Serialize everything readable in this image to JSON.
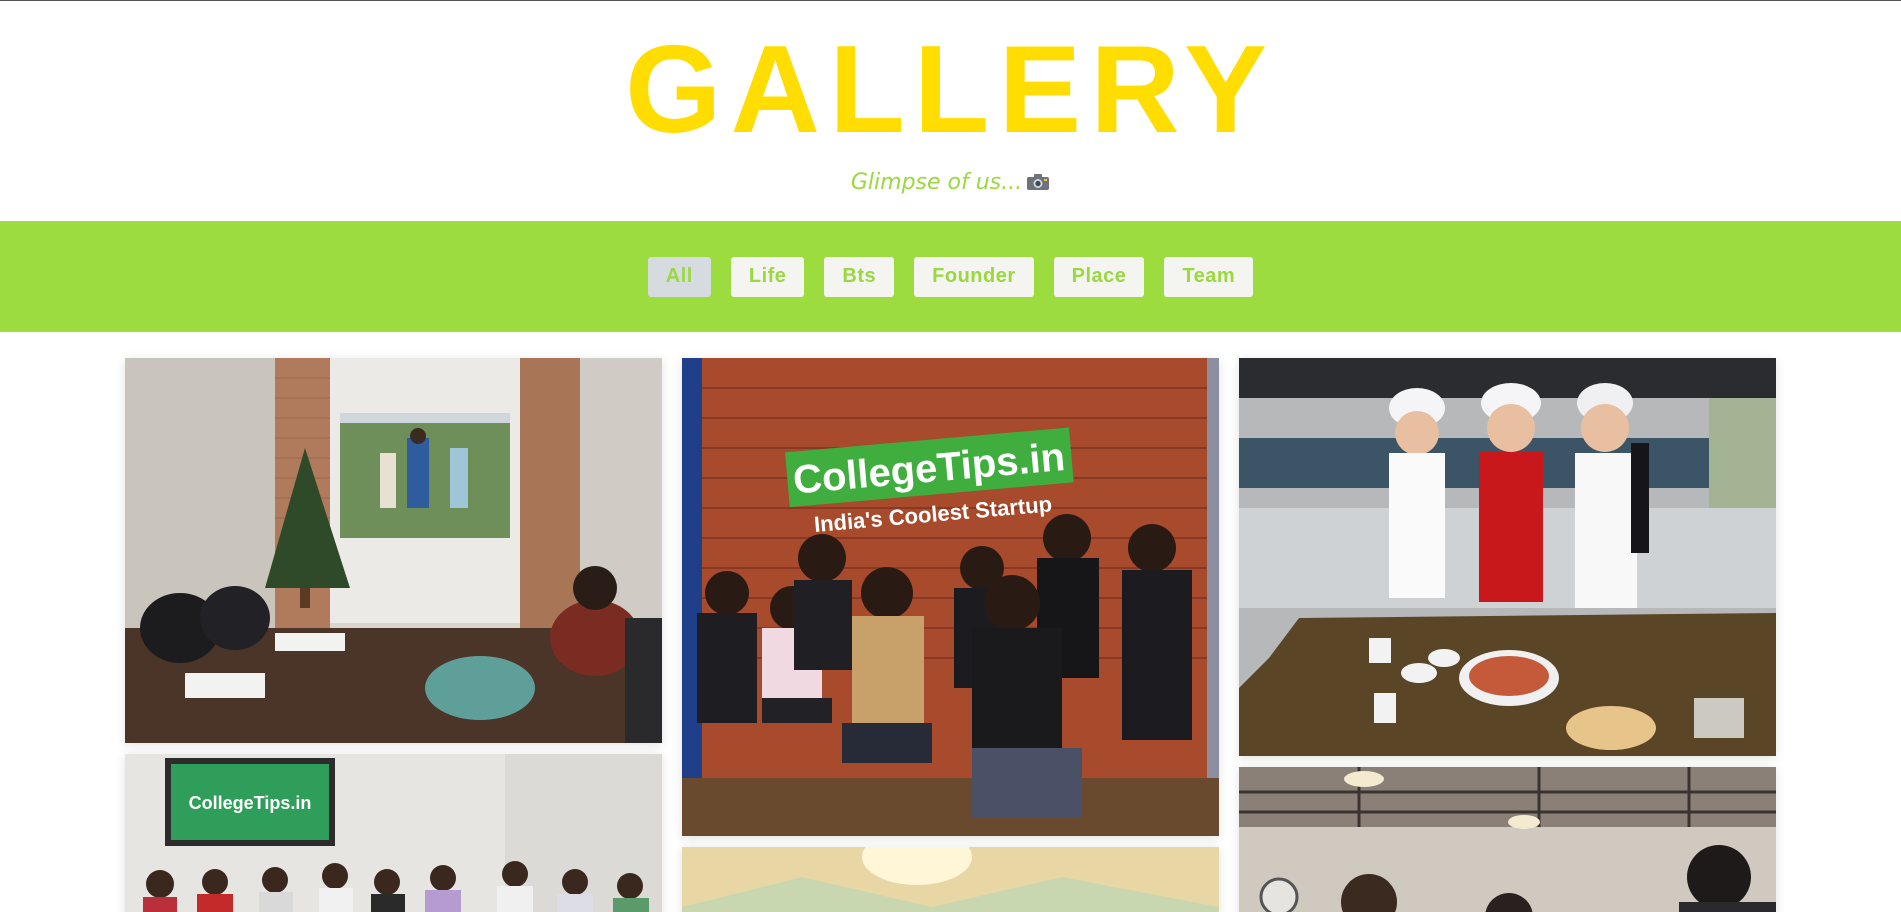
{
  "header": {
    "title": "GALLERY",
    "subtitle": "Glimpse of us..."
  },
  "filters": [
    {
      "label": "All",
      "active": true
    },
    {
      "label": "Life",
      "active": false
    },
    {
      "label": "Bts",
      "active": false
    },
    {
      "label": "Founder",
      "active": false
    },
    {
      "label": "Place",
      "active": false
    },
    {
      "label": "Team",
      "active": false
    }
  ],
  "photos": {
    "p2": {
      "brand": "CollegeTips.in",
      "tagline": "India's Coolest Startup"
    },
    "p4": {
      "brand": "CollegeTips.in"
    }
  },
  "colors": {
    "accent_yellow": "#ffdd00",
    "accent_green": "#9cdc3f",
    "button_bg": "#f4f5f1",
    "button_active_bg": "#d6dbe0"
  }
}
